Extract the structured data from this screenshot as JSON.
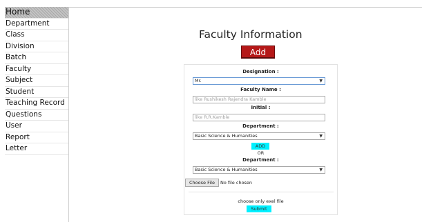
{
  "sidebar": {
    "items": [
      {
        "label": "Home"
      },
      {
        "label": "Department"
      },
      {
        "label": "Class"
      },
      {
        "label": "Division"
      },
      {
        "label": "Batch"
      },
      {
        "label": "Faculty"
      },
      {
        "label": "Subject"
      },
      {
        "label": "Student"
      },
      {
        "label": "Teaching Record"
      },
      {
        "label": "Questions"
      },
      {
        "label": "User"
      },
      {
        "label": "Report"
      },
      {
        "label": "Letter"
      }
    ]
  },
  "header": {
    "title": "Faculty Information",
    "add_label": "Add"
  },
  "form": {
    "designation_label": "Designation :",
    "designation_value": "Mr.",
    "faculty_name_label": "Faculty Name :",
    "faculty_name_placeholder": "like Rushikesh Rajendra Kamble",
    "initial_label": "Initial :",
    "initial_placeholder": "like R.R.Kamble",
    "department_label": "Department :",
    "department_value": "Basic Science & Humanities",
    "add_label": "ADD",
    "or_text": "OR",
    "department2_label": "Department :",
    "department2_value": "Basic Science & Humanities",
    "choose_file_label": "Choose File",
    "file_status": "No file chosen",
    "hint": "choose only exel file",
    "submit_label": "Submit"
  },
  "colors": {
    "add_button": "#b51818",
    "action_button": "#00f0ff"
  },
  "icons": {
    "dropdown": "chevron-down-icon"
  }
}
